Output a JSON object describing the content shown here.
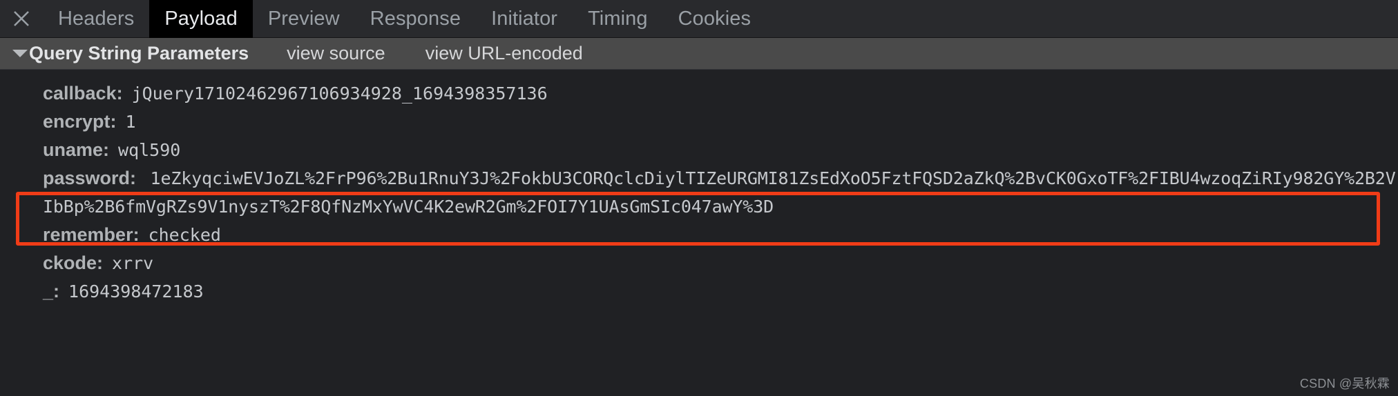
{
  "window": {
    "background_color": "#202124",
    "accent_color": "#f03c17"
  },
  "tabbar": {
    "close_icon": "close-icon",
    "tabs": [
      {
        "label": "Headers",
        "selected": false
      },
      {
        "label": "Payload",
        "selected": true
      },
      {
        "label": "Preview",
        "selected": false
      },
      {
        "label": "Response",
        "selected": false
      },
      {
        "label": "Initiator",
        "selected": false
      },
      {
        "label": "Timing",
        "selected": false
      },
      {
        "label": "Cookies",
        "selected": false
      }
    ]
  },
  "section": {
    "disclosure_icon": "triangle-down-icon",
    "title": "Query String Parameters",
    "view_source_label": "view source",
    "view_url_encoded_label": "view URL-encoded"
  },
  "params": [
    {
      "name": "callback:",
      "value": "jQuery17102462967106934928_1694398357136"
    },
    {
      "name": "encrypt:",
      "value": "1"
    },
    {
      "name": "uname:",
      "value": "wql590"
    },
    {
      "name": "password:",
      "value": "1eZkyqciwEVJoZL%2FrP96%2Bu1RnuY3J%2FokbU3CORQclcDiylTIZeURGMI81ZsEdXoO5FztFQSD2aZkQ%2BvCK0GxoTF%2FIBU4wzoqZiRIy982GY%2B2VIbBp%2B6fmVgRZs9V1nyszT%2F8QfNzMxYwVC4K2ewR2Gm%2FOI7Y1UAsGmSIc047awY%3D"
    },
    {
      "name": "remember:",
      "value": "checked"
    },
    {
      "name": "ckode:",
      "value": "xrrv"
    },
    {
      "name": "_:",
      "value": "1694398472183"
    }
  ],
  "annotation": {
    "name": "password-highlight-box",
    "color": "#f03c17"
  },
  "watermark": {
    "text": "CSDN @吴秋霖"
  }
}
